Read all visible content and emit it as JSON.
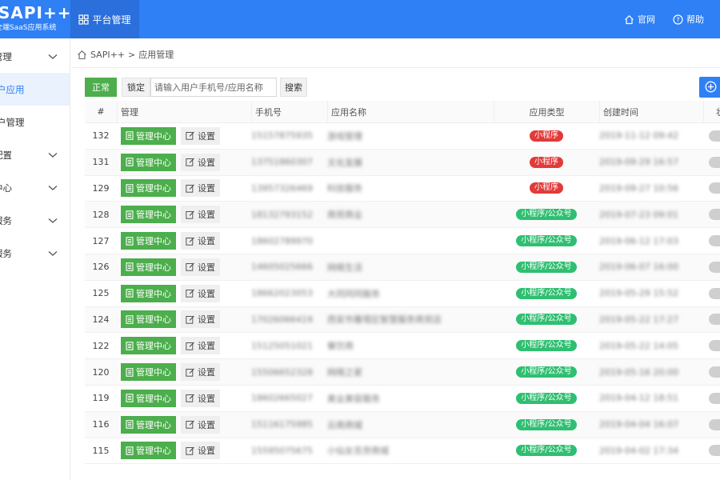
{
  "header": {
    "logo_title": "SAPI++",
    "logo_sub": "全端SaaS应用系统",
    "nav_tab": "平台管理",
    "links": {
      "official": "官网",
      "help": "帮助"
    }
  },
  "sidebar": {
    "items": [
      {
        "label": "管理",
        "expandable": true
      },
      {
        "label": "户应用",
        "active": true
      },
      {
        "label": "户管理"
      },
      {
        "label": "配置",
        "expandable": true
      },
      {
        "label": "中心",
        "expandable": true
      },
      {
        "label": "服务",
        "expandable": true
      },
      {
        "label": "服务",
        "expandable": true
      }
    ]
  },
  "breadcrumb": {
    "home": "SAPI++",
    "sep": ">",
    "current": "应用管理"
  },
  "toolbar": {
    "status_label": "正常",
    "lock_label": "锁定",
    "search_placeholder": "请输入用户手机号/应用名称",
    "search_label": "搜索"
  },
  "table": {
    "headers": {
      "id": "#",
      "manage": "管理",
      "phone": "手机号",
      "name": "应用名称",
      "type": "应用类型",
      "date": "创建时间",
      "status": "状"
    },
    "manage_label": "管理中心",
    "settings_label": "设置",
    "rows": [
      {
        "id": "132",
        "phone": "15157875935",
        "name": "游戏管理",
        "type": "小程序",
        "type_color": "red",
        "date": "2019-11-12 09:42"
      },
      {
        "id": "131",
        "phone": "13751860307",
        "name": "文化发展",
        "type": "小程序",
        "type_color": "red",
        "date": "2019-09-29 16:57"
      },
      {
        "id": "129",
        "phone": "13957326469",
        "name": "科技服务",
        "type": "小程序",
        "type_color": "red",
        "date": "2019-09-27 10:56"
      },
      {
        "id": "128",
        "phone": "18132793152",
        "name": "商贸商业",
        "type": "小程序/公众号",
        "type_color": "green",
        "date": "2019-07-23 09:01"
      },
      {
        "id": "127",
        "phone": "18602789970",
        "name": "",
        "type": "小程序/公众号",
        "type_color": "green",
        "date": "2019-06-12 17:03"
      },
      {
        "id": "126",
        "phone": "14605025666",
        "name": "网络生活",
        "type": "小程序/公众号",
        "type_color": "green",
        "date": "2019-06-07 16:00"
      },
      {
        "id": "125",
        "phone": "18662023053",
        "name": "大同同同服务",
        "type": "小程序/公众号",
        "type_color": "green",
        "date": "2019-05-29 15:52"
      },
      {
        "id": "124",
        "phone": "17026066419",
        "name": "西安市雁塔区智慧服务商贸店",
        "type": "小程序/公众号",
        "type_color": "green",
        "date": "2019-05-22 17:27"
      },
      {
        "id": "122",
        "phone": "15125051021",
        "name": "餐饮商",
        "type": "小程序/公众号",
        "type_color": "green",
        "date": "2019-05-22 14:05"
      },
      {
        "id": "120",
        "phone": "15506652328",
        "name": "网络之家",
        "type": "小程序/公众号",
        "type_color": "green",
        "date": "2019-05-16 20:00"
      },
      {
        "id": "119",
        "phone": "18602665027",
        "name": "美业美容服务",
        "type": "小程序/公众号",
        "type_color": "green",
        "date": "2019-04-12 18:51"
      },
      {
        "id": "116",
        "phone": "15116175985",
        "name": "云南商城",
        "type": "小程序/公众号",
        "type_color": "green",
        "date": "2019-04-04 16:07"
      },
      {
        "id": "115",
        "phone": "15595075675",
        "name": "小仙女百货商城",
        "type": "小程序/公众号",
        "type_color": "green",
        "date": "2019-04-02 17:34"
      }
    ]
  },
  "colors": {
    "primary": "#2f7ff5",
    "success": "#4cae4c",
    "badge_red": "#e23a3a",
    "badge_green": "#2fbf71"
  }
}
